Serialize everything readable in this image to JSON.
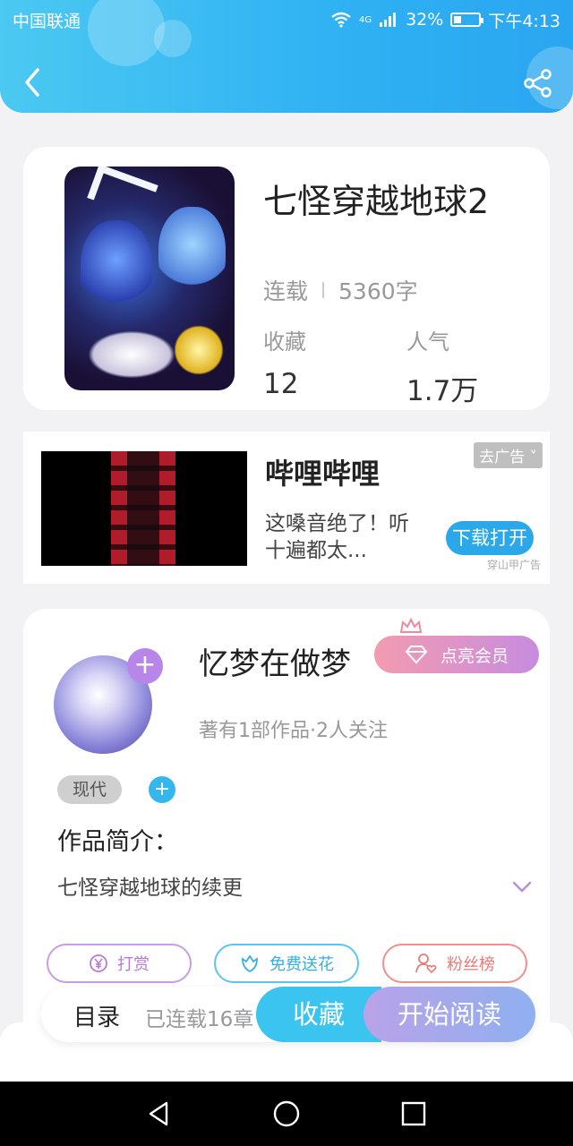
{
  "status": {
    "carrier": "中国联通",
    "network": "4G",
    "battery": "32%",
    "time": "下午4:13"
  },
  "book": {
    "title": "七怪穿越地球2",
    "status": "连载",
    "words": "5360字",
    "favorites_label": "收藏",
    "favorites_value": "12",
    "popularity_label": "人气",
    "popularity_value": "1.7万"
  },
  "ad": {
    "title": "哔哩哔哩",
    "desc": "这嗓音绝了！听十遍都太...",
    "skip": "去广告",
    "button": "下载打开",
    "source": "穿山甲广告"
  },
  "author": {
    "name": "忆梦在做梦",
    "vip_button": "点亮会员",
    "sub": "著有1部作品·2人关注",
    "tag": "现代",
    "intro_label": "作品简介：",
    "intro_text": "七怪穿越地球的续更"
  },
  "pills": {
    "reward": "打赏",
    "flower": "免费送花",
    "fans": "粉丝榜"
  },
  "bottom": {
    "toc": "目录",
    "toc_sub": "已连载16章",
    "favorite": "收藏",
    "read": "开始阅读"
  },
  "colors": {
    "header": "#2fb1f3",
    "accent_blue": "#3bc4ef",
    "accent_purple": "#b885e8"
  }
}
